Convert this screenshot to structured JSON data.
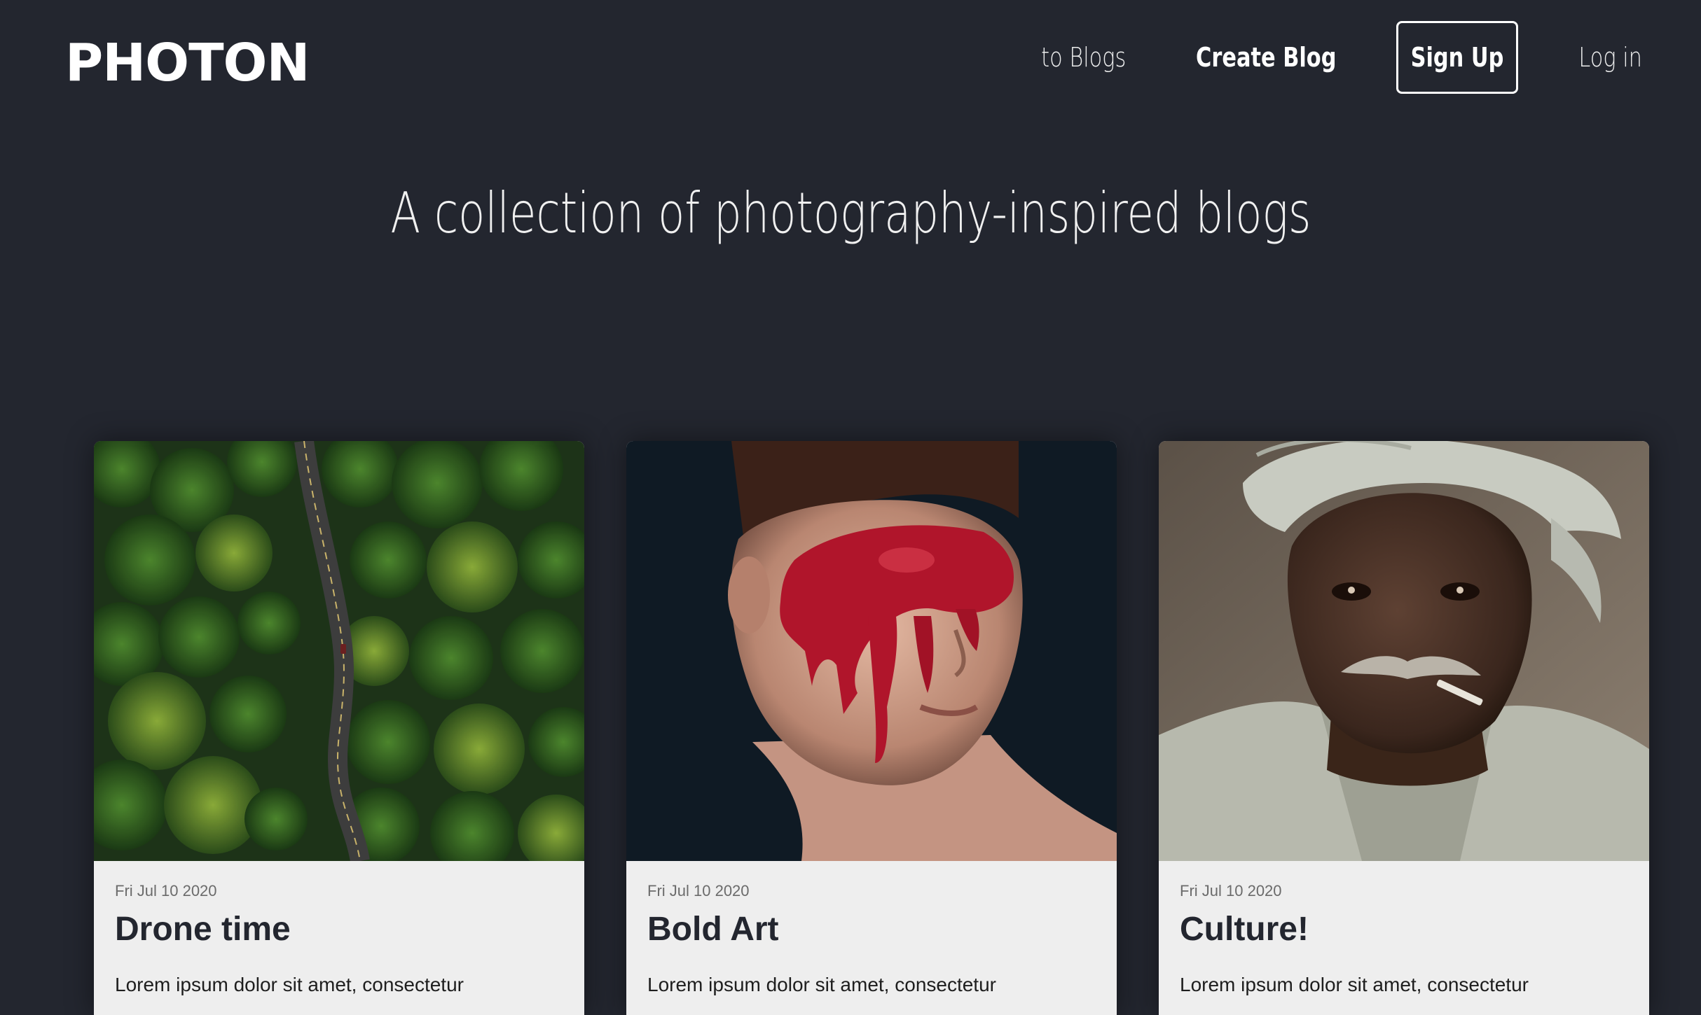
{
  "header": {
    "logo": "PHOTON",
    "nav": {
      "to_blogs": "to Blogs",
      "create_blog": "Create Blog",
      "sign_up": "Sign Up",
      "log_in": "Log in"
    }
  },
  "hero": {
    "title": "A collection of photography-inspired blogs"
  },
  "cards": [
    {
      "date": "Fri Jul 10 2020",
      "title": "Drone time",
      "excerpt": "Lorem ipsum dolor sit amet, consectetur",
      "image": "aerial-forest-road-photo"
    },
    {
      "date": "Fri Jul 10 2020",
      "title": "Bold Art",
      "excerpt": "Lorem ipsum dolor sit amet, consectetur",
      "image": "red-paint-face-portrait-photo"
    },
    {
      "date": "Fri Jul 10 2020",
      "title": "Culture!",
      "excerpt": "Lorem ipsum dolor sit amet, consectetur",
      "image": "turbaned-man-portrait-photo"
    }
  ],
  "colors": {
    "background": "#23262f",
    "card_body": "#eeeeee",
    "text_light": "#ffffff",
    "title_dark": "#23262f"
  }
}
